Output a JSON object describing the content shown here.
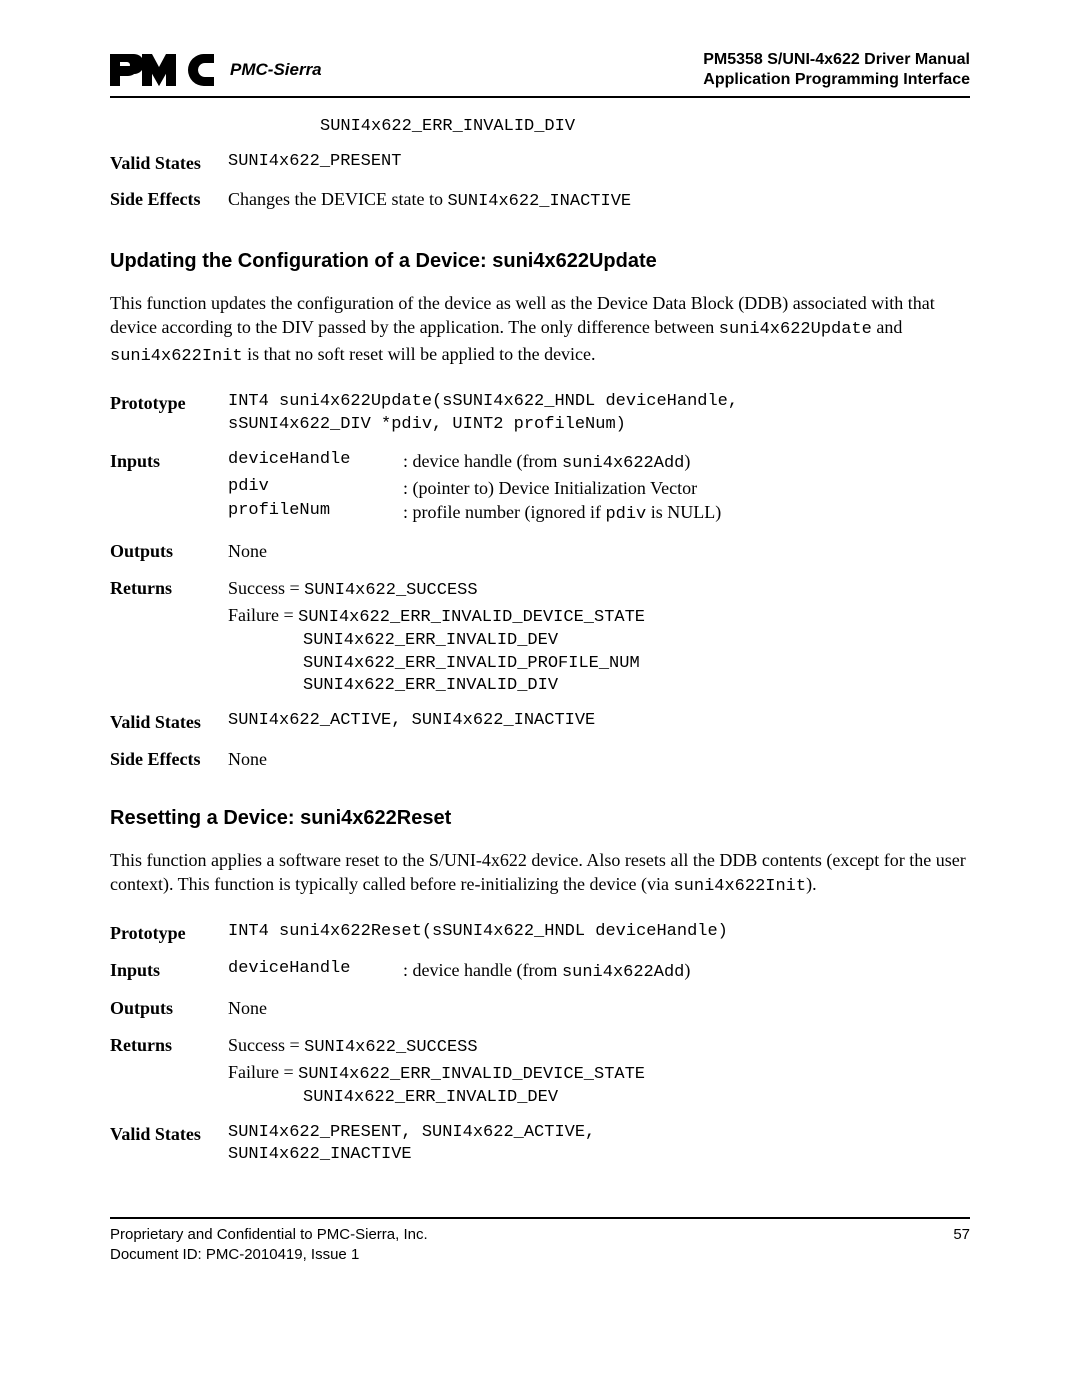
{
  "header": {
    "brand": "PMC-Sierra",
    "title1": "PM5358 S/UNI-4x622 Driver Manual",
    "title2": "Application Programming Interface"
  },
  "top": {
    "overflow_err": "SUNI4x622_ERR_INVALID_DIV",
    "valid_states_label": "Valid States",
    "valid_states_value": "SUNI4x622_PRESENT",
    "side_effects_label": "Side Effects",
    "side_effects_pre": "Changes the DEVICE state to ",
    "side_effects_code": "SUNI4x622_INACTIVE"
  },
  "update": {
    "heading": "Updating the Configuration of a Device: suni4x622Update",
    "desc_a": "This function updates the configuration of the device as well as the Device Data Block (DDB) associated with that device according to the DIV passed by the application. The only difference between ",
    "desc_code1": "suni4x622Update",
    "desc_b": " and ",
    "desc_code2": "suni4x622Init",
    "desc_c": " is that no soft reset will be applied to the device.",
    "proto_label": "Prototype",
    "proto_line1": "INT4 suni4x622Update(sSUNI4x622_HNDL deviceHandle,",
    "proto_line2": "sSUNI4x622_DIV *pdiv, UINT2 profileNum)",
    "inputs_label": "Inputs",
    "in1_name": "deviceHandle",
    "in1_pre": ": device handle (from ",
    "in1_code": "suni4x622Add",
    "in1_post": ")",
    "in2_name": "pdiv",
    "in2_desc": ": (pointer to) Device Initialization Vector",
    "in3_name": "profileNum",
    "in3_pre": ": profile number (ignored if ",
    "in3_code": "pdiv",
    "in3_post": " is NULL)",
    "outputs_label": "Outputs",
    "outputs_value": "None",
    "returns_label": "Returns",
    "ret_success_pre": "Success = ",
    "ret_success_code": "SUNI4x622_SUCCESS",
    "ret_failure_pre": "Failure = ",
    "ret_failure_code1": "SUNI4x622_ERR_INVALID_DEVICE_STATE",
    "ret_failure_code2": "SUNI4x622_ERR_INVALID_DEV",
    "ret_failure_code3": "SUNI4x622_ERR_INVALID_PROFILE_NUM",
    "ret_failure_code4": "SUNI4x622_ERR_INVALID_DIV",
    "valid_states_label": "Valid States",
    "valid_states_value": "SUNI4x622_ACTIVE, SUNI4x622_INACTIVE",
    "side_effects_label": "Side Effects",
    "side_effects_value": "None"
  },
  "reset": {
    "heading": "Resetting a Device: suni4x622Reset",
    "desc_a": "This function applies a software reset to the S/UNI-4x622 device. Also resets all the DDB contents (except for the user context). This function is typically called before re-initializing the device (via ",
    "desc_code": "suni4x622Init",
    "desc_b": ").",
    "proto_label": "Prototype",
    "proto_value": "INT4 suni4x622Reset(sSUNI4x622_HNDL deviceHandle)",
    "inputs_label": "Inputs",
    "in1_name": "deviceHandle",
    "in1_pre": ": device handle (from ",
    "in1_code": "suni4x622Add",
    "in1_post": ")",
    "outputs_label": "Outputs",
    "outputs_value": "None",
    "returns_label": "Returns",
    "ret_success_pre": "Success = ",
    "ret_success_code": "SUNI4x622_SUCCESS",
    "ret_failure_pre": "Failure = ",
    "ret_failure_code1": "SUNI4x622_ERR_INVALID_DEVICE_STATE",
    "ret_failure_code2": "SUNI4x622_ERR_INVALID_DEV",
    "valid_states_label": "Valid States",
    "valid_states_line1": "SUNI4x622_PRESENT, SUNI4x622_ACTIVE,",
    "valid_states_line2": "SUNI4x622_INACTIVE"
  },
  "footer": {
    "line1": "Proprietary and Confidential to PMC-Sierra, Inc.",
    "line2": "Document ID: PMC-2010419, Issue 1",
    "page": "57"
  }
}
